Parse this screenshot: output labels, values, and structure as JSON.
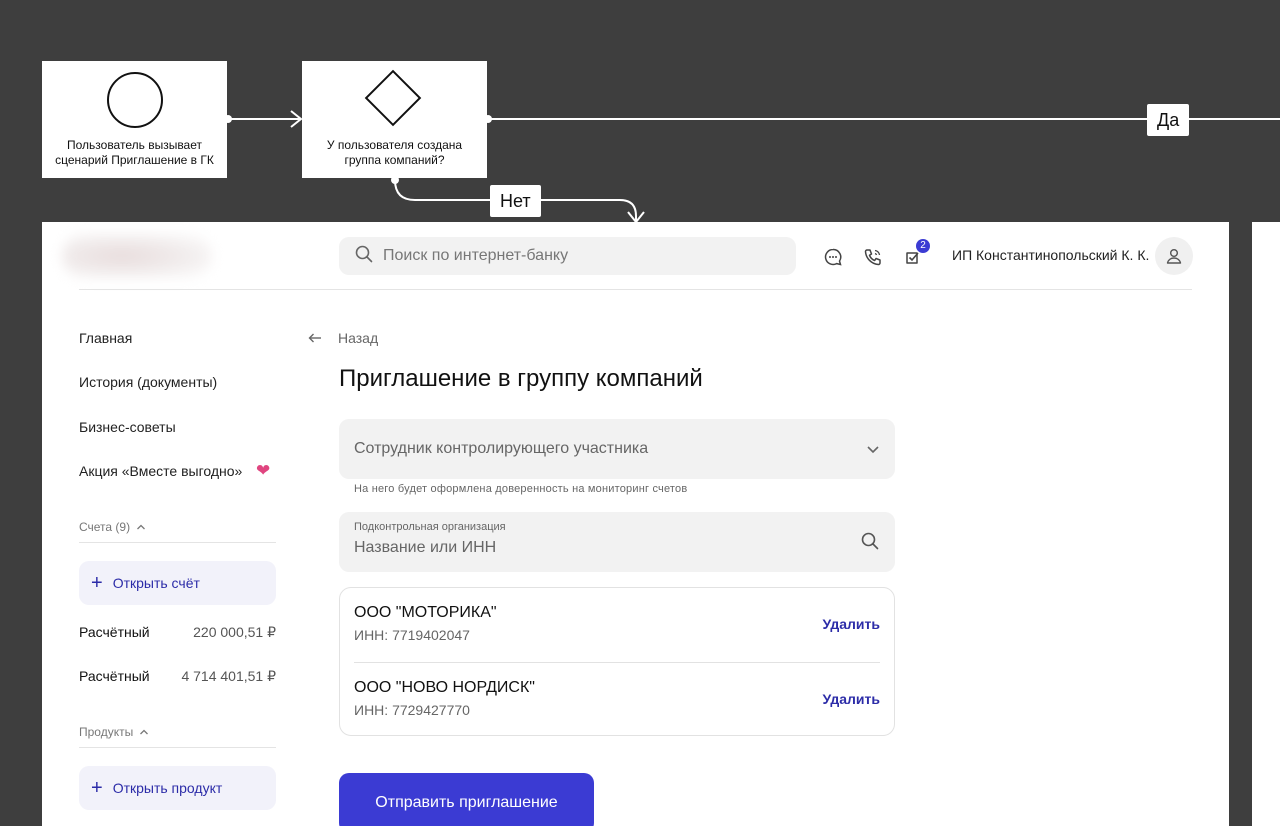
{
  "flow": {
    "start_node_label": "Пользователь вызывает сценарий Приглашение в ГК",
    "decision_node_label": "У пользователя создана группа компаний?",
    "yes_label": "Да",
    "no_label": "Нет"
  },
  "header": {
    "search_placeholder": "Поиск по интернет-банку",
    "tasks_badge": "2",
    "user_name": "ИП Константинопольский К. К."
  },
  "sidebar": {
    "items": [
      {
        "label": "Главная"
      },
      {
        "label": "История (документы)"
      },
      {
        "label": "Бизнес-советы"
      },
      {
        "label": "Акция «Вместе выгодно»"
      }
    ],
    "accounts_header": "Счета (9)",
    "open_account_label": "Открыть счёт",
    "accounts": [
      {
        "name": "Расчётный",
        "amount": "220 000,51 ₽"
      },
      {
        "name": "Расчётный",
        "amount": "4 714 401,51 ₽"
      }
    ],
    "products_header": "Продукты",
    "open_product_label": "Открыть продукт"
  },
  "main": {
    "back_label": "Назад",
    "title": "Приглашение в группу компаний",
    "employee_select_placeholder": "Сотрудник контролирующего участника",
    "employee_hint": "На него будет оформлена доверенность на мониторинг счетов",
    "org_field_label": "Подконтрольная организация",
    "org_field_placeholder": "Название или ИНН",
    "organizations": [
      {
        "name": "ООО \"МОТОРИКА\"",
        "inn": "ИНН: 7719402047",
        "delete_label": "Удалить"
      },
      {
        "name": "ООО \"НОВО НОРДИСК\"",
        "inn": "ИНН: 7729427770",
        "delete_label": "Удалить"
      }
    ],
    "submit_label": "Отправить приглашение"
  },
  "colors": {
    "accent": "#3b3bd3",
    "link": "#2c2ca8",
    "canvas": "#3e3e3e"
  }
}
